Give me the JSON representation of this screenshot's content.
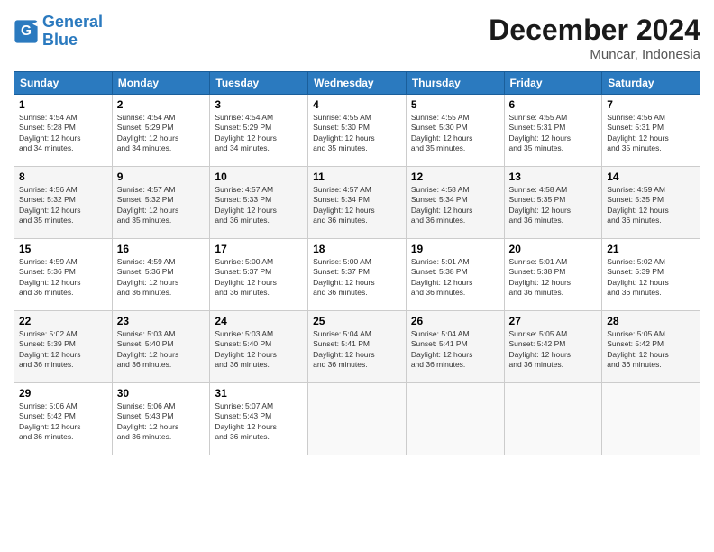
{
  "header": {
    "logo_line1": "General",
    "logo_line2": "Blue",
    "month_title": "December 2024",
    "location": "Muncar, Indonesia"
  },
  "weekdays": [
    "Sunday",
    "Monday",
    "Tuesday",
    "Wednesday",
    "Thursday",
    "Friday",
    "Saturday"
  ],
  "weeks": [
    [
      {
        "day": "1",
        "info": "Sunrise: 4:54 AM\nSunset: 5:28 PM\nDaylight: 12 hours\nand 34 minutes."
      },
      {
        "day": "2",
        "info": "Sunrise: 4:54 AM\nSunset: 5:29 PM\nDaylight: 12 hours\nand 34 minutes."
      },
      {
        "day": "3",
        "info": "Sunrise: 4:54 AM\nSunset: 5:29 PM\nDaylight: 12 hours\nand 34 minutes."
      },
      {
        "day": "4",
        "info": "Sunrise: 4:55 AM\nSunset: 5:30 PM\nDaylight: 12 hours\nand 35 minutes."
      },
      {
        "day": "5",
        "info": "Sunrise: 4:55 AM\nSunset: 5:30 PM\nDaylight: 12 hours\nand 35 minutes."
      },
      {
        "day": "6",
        "info": "Sunrise: 4:55 AM\nSunset: 5:31 PM\nDaylight: 12 hours\nand 35 minutes."
      },
      {
        "day": "7",
        "info": "Sunrise: 4:56 AM\nSunset: 5:31 PM\nDaylight: 12 hours\nand 35 minutes."
      }
    ],
    [
      {
        "day": "8",
        "info": "Sunrise: 4:56 AM\nSunset: 5:32 PM\nDaylight: 12 hours\nand 35 minutes."
      },
      {
        "day": "9",
        "info": "Sunrise: 4:57 AM\nSunset: 5:32 PM\nDaylight: 12 hours\nand 35 minutes."
      },
      {
        "day": "10",
        "info": "Sunrise: 4:57 AM\nSunset: 5:33 PM\nDaylight: 12 hours\nand 36 minutes."
      },
      {
        "day": "11",
        "info": "Sunrise: 4:57 AM\nSunset: 5:34 PM\nDaylight: 12 hours\nand 36 minutes."
      },
      {
        "day": "12",
        "info": "Sunrise: 4:58 AM\nSunset: 5:34 PM\nDaylight: 12 hours\nand 36 minutes."
      },
      {
        "day": "13",
        "info": "Sunrise: 4:58 AM\nSunset: 5:35 PM\nDaylight: 12 hours\nand 36 minutes."
      },
      {
        "day": "14",
        "info": "Sunrise: 4:59 AM\nSunset: 5:35 PM\nDaylight: 12 hours\nand 36 minutes."
      }
    ],
    [
      {
        "day": "15",
        "info": "Sunrise: 4:59 AM\nSunset: 5:36 PM\nDaylight: 12 hours\nand 36 minutes."
      },
      {
        "day": "16",
        "info": "Sunrise: 4:59 AM\nSunset: 5:36 PM\nDaylight: 12 hours\nand 36 minutes."
      },
      {
        "day": "17",
        "info": "Sunrise: 5:00 AM\nSunset: 5:37 PM\nDaylight: 12 hours\nand 36 minutes."
      },
      {
        "day": "18",
        "info": "Sunrise: 5:00 AM\nSunset: 5:37 PM\nDaylight: 12 hours\nand 36 minutes."
      },
      {
        "day": "19",
        "info": "Sunrise: 5:01 AM\nSunset: 5:38 PM\nDaylight: 12 hours\nand 36 minutes."
      },
      {
        "day": "20",
        "info": "Sunrise: 5:01 AM\nSunset: 5:38 PM\nDaylight: 12 hours\nand 36 minutes."
      },
      {
        "day": "21",
        "info": "Sunrise: 5:02 AM\nSunset: 5:39 PM\nDaylight: 12 hours\nand 36 minutes."
      }
    ],
    [
      {
        "day": "22",
        "info": "Sunrise: 5:02 AM\nSunset: 5:39 PM\nDaylight: 12 hours\nand 36 minutes."
      },
      {
        "day": "23",
        "info": "Sunrise: 5:03 AM\nSunset: 5:40 PM\nDaylight: 12 hours\nand 36 minutes."
      },
      {
        "day": "24",
        "info": "Sunrise: 5:03 AM\nSunset: 5:40 PM\nDaylight: 12 hours\nand 36 minutes."
      },
      {
        "day": "25",
        "info": "Sunrise: 5:04 AM\nSunset: 5:41 PM\nDaylight: 12 hours\nand 36 minutes."
      },
      {
        "day": "26",
        "info": "Sunrise: 5:04 AM\nSunset: 5:41 PM\nDaylight: 12 hours\nand 36 minutes."
      },
      {
        "day": "27",
        "info": "Sunrise: 5:05 AM\nSunset: 5:42 PM\nDaylight: 12 hours\nand 36 minutes."
      },
      {
        "day": "28",
        "info": "Sunrise: 5:05 AM\nSunset: 5:42 PM\nDaylight: 12 hours\nand 36 minutes."
      }
    ],
    [
      {
        "day": "29",
        "info": "Sunrise: 5:06 AM\nSunset: 5:42 PM\nDaylight: 12 hours\nand 36 minutes."
      },
      {
        "day": "30",
        "info": "Sunrise: 5:06 AM\nSunset: 5:43 PM\nDaylight: 12 hours\nand 36 minutes."
      },
      {
        "day": "31",
        "info": "Sunrise: 5:07 AM\nSunset: 5:43 PM\nDaylight: 12 hours\nand 36 minutes."
      },
      null,
      null,
      null,
      null
    ]
  ]
}
